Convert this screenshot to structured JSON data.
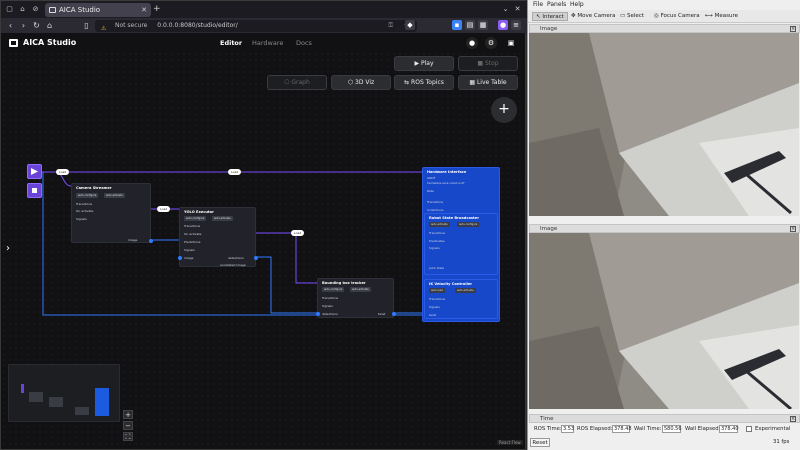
{
  "browser": {
    "tab_title": "AICA Studio",
    "not_secure": "Not secure",
    "url": "0.0.0.0:8080/studio/editor/"
  },
  "app": {
    "brand": "AICA Studio",
    "nav": [
      "Editor",
      "Hardware",
      "Docs"
    ],
    "buttons": {
      "play": "Play",
      "stop": "Stop",
      "graph": "Graph",
      "viz3d": "3D Viz",
      "ros_topics": "ROS Topics",
      "live_table": "Live Table"
    },
    "react_flow": "React Flow"
  },
  "graph": {
    "event_labels": [
      "Load",
      "Load",
      "Load",
      "Load"
    ],
    "nodes": {
      "camera": {
        "title": "Camera Streamer",
        "chips": [
          "auto-configure",
          "auto-activate"
        ],
        "rows": [
          "Transitions",
          "On activate",
          "Signals"
        ],
        "out": "image"
      },
      "yolo": {
        "title": "YOLO Executor",
        "chips": [
          "auto-configure",
          "auto-activate"
        ],
        "rows": [
          "Transitions",
          "On activate",
          "Predictions",
          "Signals"
        ],
        "ports": [
          "image",
          "detections",
          "annotated image"
        ]
      },
      "tracker": {
        "title": "Bounding box tracker",
        "chips": [
          "auto-configure",
          "auto-activate"
        ],
        "rows": [
          "Transitions",
          "Signals"
        ],
        "ports": [
          "detections",
          "twist"
        ]
      },
      "hw": {
        "title": "Hardware Interface",
        "rows": [
          "URDF",
          "Rate",
          "Transitions",
          "Collections"
        ],
        "urdf": "hardware-aica-robot.urdf"
      },
      "broadcaster": {
        "title": "Robot State Broadcaster",
        "chips": [
          "auto-activate",
          "auto-configure"
        ],
        "rows": [
          "Transitions",
          "Predicates",
          "Signals",
          "joint state"
        ]
      },
      "velocity": {
        "title": "IK Velocity Controller",
        "chips": [
          "auto-load",
          "auto-activate"
        ],
        "rows": [
          "Transitions",
          "Signals",
          "twist"
        ]
      }
    }
  },
  "rviz": {
    "menu": [
      "File",
      "Panels",
      "Help"
    ],
    "tools": [
      "Interact",
      "Move Camera",
      "Select",
      "Focus Camera",
      "Measure"
    ],
    "panels": [
      "Image",
      "Image"
    ],
    "time_title": "Time",
    "ros_time_label": "ROS Time:",
    "ros_time": "3.53",
    "ros_elapsed_label": "ROS Elapsed:",
    "ros_elapsed": "378.48",
    "wall_time_label": "Wall Time:",
    "wall_time": "580.56",
    "wall_elapsed_label": "Wall Elapsed:",
    "wall_elapsed": "378.40",
    "experimental": "Experimental",
    "reset": "Reset",
    "fps": "31 fps"
  }
}
